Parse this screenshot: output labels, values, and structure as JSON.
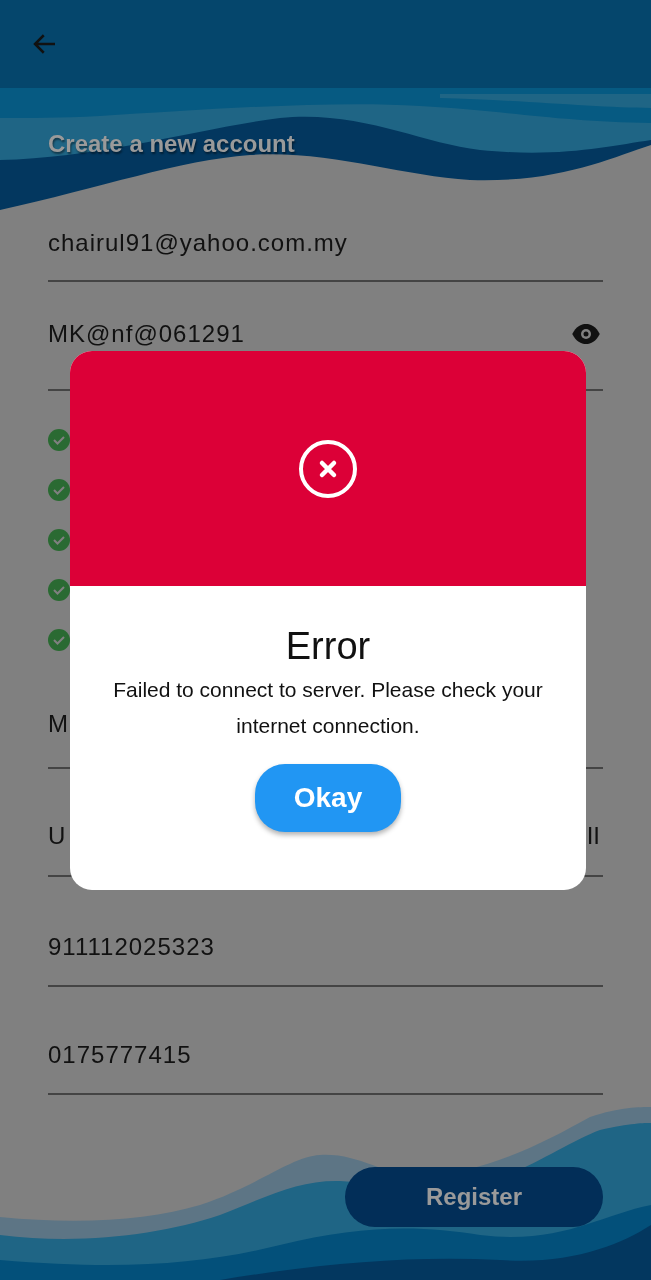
{
  "header": {
    "subtitle": "Create a new account"
  },
  "form": [
    {
      "kind": "text",
      "value": "chairul91@yahoo.com.my"
    },
    {
      "kind": "password",
      "value": "MK@nf@061291"
    },
    {
      "kind": "checklist",
      "items": [
        {
          "met": true
        },
        {
          "met": true
        },
        {
          "met": true
        },
        {
          "met": true
        },
        {
          "met": true
        }
      ]
    },
    {
      "kind": "text",
      "value": "M"
    },
    {
      "kind": "text",
      "value": "U",
      "trailing": "II"
    },
    {
      "kind": "text",
      "value": "911112025323"
    },
    {
      "kind": "text",
      "value": "0175777415"
    }
  ],
  "register_button": {
    "label": "Register"
  },
  "dialog": {
    "title": "Error",
    "message": "Failed to connect to server. Please check your internet connection.",
    "button": "Okay"
  }
}
